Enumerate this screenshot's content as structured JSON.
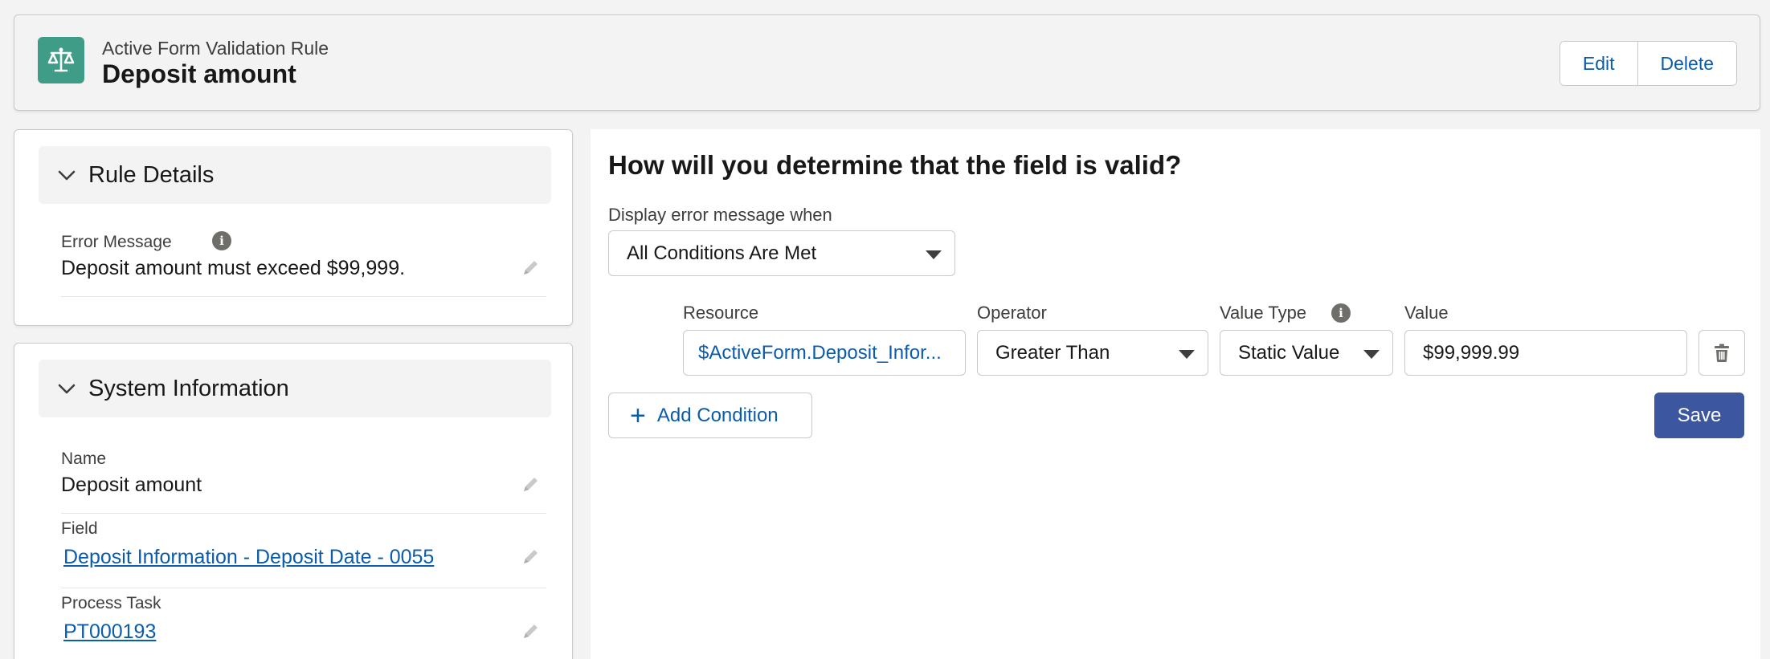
{
  "header": {
    "icon": "scales-icon",
    "subtitle": "Active Form Validation Rule",
    "title": "Deposit amount",
    "edit_label": "Edit",
    "delete_label": "Delete"
  },
  "rule_details": {
    "section_title": "Rule Details",
    "error_message_label": "Error Message",
    "error_message_value": "Deposit amount must exceed $99,999."
  },
  "system_info": {
    "section_title": "System Information",
    "name_label": "Name",
    "name_value": "Deposit amount",
    "field_label": "Field",
    "field_value": "Deposit Information - Deposit Date - 0055",
    "process_task_label": "Process Task",
    "process_task_value": "PT000193"
  },
  "validation": {
    "heading": "How will you determine that the field is valid?",
    "display_when_label": "Display error message when",
    "display_when_value": "All Conditions Are Met",
    "condition": {
      "resource_label": "Resource",
      "resource_value": "$ActiveForm.Deposit_Infor...",
      "operator_label": "Operator",
      "operator_value": "Greater Than",
      "value_type_label": "Value Type",
      "value_type_value": "Static Value",
      "value_label": "Value",
      "value_value": "$99,999.99"
    },
    "add_condition_label": "Add Condition",
    "save_label": "Save"
  },
  "colors": {
    "brand_icon": "#3f9c86",
    "link": "#0b5cab",
    "primary_button": "#3d56a0"
  }
}
